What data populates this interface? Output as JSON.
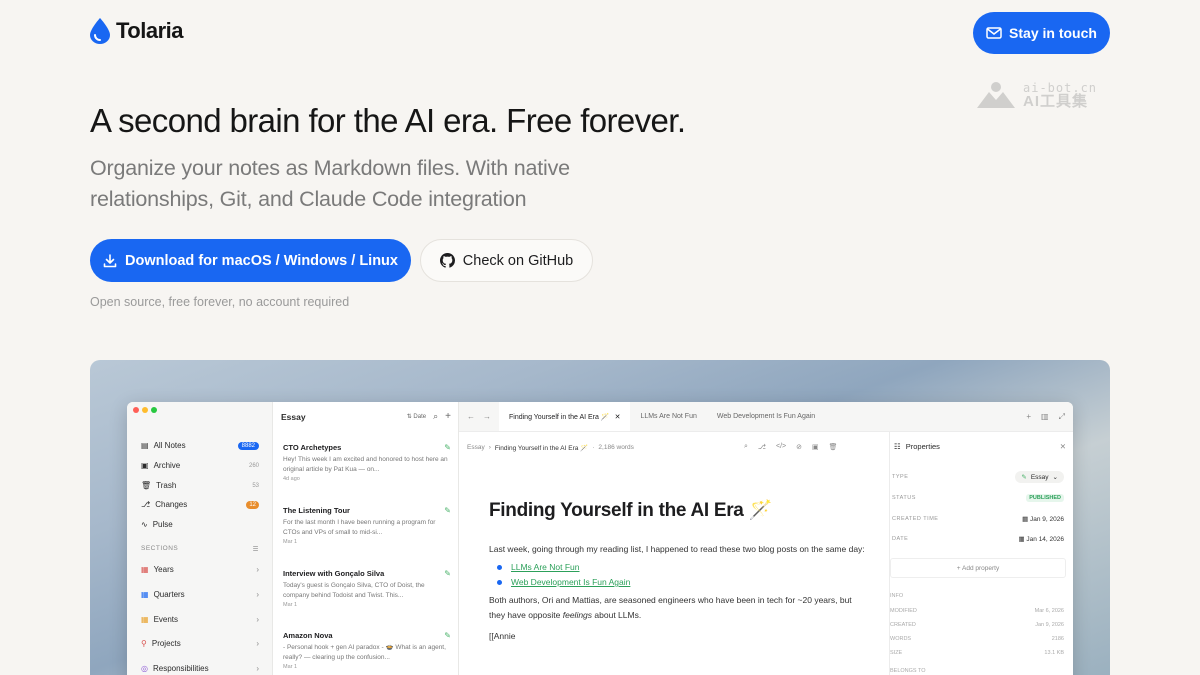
{
  "brand": {
    "name": "Tolaria",
    "accent": "#1967f2"
  },
  "nav": {
    "cta_label": "Stay in touch"
  },
  "watermark": {
    "line1": "ai-bot.cn",
    "line2": "AI工具集"
  },
  "hero": {
    "headline": "A second brain for the AI era. Free forever.",
    "subtitle": "Organize your notes as Markdown files. With native relationships, Git, and Claude Code integration",
    "download_label": "Download for macOS / Windows / Linux",
    "github_label": "Check on GitHub",
    "note": "Open source, free forever, no account required"
  },
  "app": {
    "sidebar": {
      "items": [
        {
          "label": "All Notes",
          "count": "8882",
          "icon": "notes-icon"
        },
        {
          "label": "Archive",
          "count": "260",
          "icon": "archive-icon"
        },
        {
          "label": "Trash",
          "count": "53",
          "icon": "trash-icon"
        },
        {
          "label": "Changes",
          "count": "12",
          "icon": "changes-icon"
        },
        {
          "label": "Pulse",
          "count": "",
          "icon": "pulse-icon"
        }
      ],
      "sections_label": "SECTIONS",
      "sections": [
        {
          "label": "Years",
          "icon": "calendar-icon"
        },
        {
          "label": "Quarters",
          "icon": "calendar-icon"
        },
        {
          "label": "Events",
          "icon": "event-icon"
        },
        {
          "label": "Projects",
          "icon": "project-icon"
        },
        {
          "label": "Responsibilities",
          "icon": "target-icon"
        }
      ]
    },
    "list": {
      "title": "Essay",
      "sort_label": "Date",
      "notes": [
        {
          "title": "CTO Archetypes",
          "preview": "Hey! This week I am excited and honored to host here an original article by Pat Kua — on...",
          "date": "4d ago"
        },
        {
          "title": "The Listening Tour",
          "preview": "For the last month I have been running a program for CTOs and VPs of small to mid-si...",
          "date": "Mar 1"
        },
        {
          "title": "Interview with Gonçalo Silva",
          "preview": "Today's guest is Gonçalo Silva, CTO of Doist, the company behind Todoist and Twist. This...",
          "date": "Mar 1"
        },
        {
          "title": "Amazon Nova",
          "preview": "- Personal hook + gen AI paradox - 🍲 What is an agent, really? — clearing up the confusion...",
          "date": "Mar 1"
        }
      ]
    },
    "tabs": [
      {
        "label": "Finding Yourself in the AI Era 🪄",
        "active": true
      },
      {
        "label": "LLMs Are Not Fun",
        "active": false
      },
      {
        "label": "Web Development Is Fun Again",
        "active": false
      }
    ],
    "breadcrumb": {
      "root": "Essay",
      "current": "Finding Yourself in the AI Era 🪄",
      "words": "2,186 words"
    },
    "doc": {
      "title": "Finding Yourself in the AI Era 🪄",
      "p1": "Last week, going through my reading list, I happened to read these two blog posts on the same day:",
      "links": [
        "LLMs Are Not Fun",
        "Web Development Is Fun Again"
      ],
      "p2_a": "Both authors, Ori and Mattias, are seasoned engineers who have been in tech for ~20 years, but they have opposite ",
      "p2_em": "feelings",
      "p2_b": " about LLMs.",
      "p3": "[[Annie"
    },
    "properties": {
      "title": "Properties",
      "type_label": "TYPE",
      "type_value": "Essay",
      "status_label": "STATUS",
      "status_value": "PUBLISHED",
      "created_label": "CREATED TIME",
      "created_value": "Jan 9, 2026",
      "date_label": "DATE",
      "date_value": "Jan 14, 2026",
      "add_label": "+ Add property",
      "info_label": "INFO",
      "info": [
        {
          "k": "MODIFIED",
          "v": "Mar 6, 2026"
        },
        {
          "k": "CREATED",
          "v": "Jan 9, 2026"
        },
        {
          "k": "WORDS",
          "v": "2186"
        },
        {
          "k": "SIZE",
          "v": "13.1 KB"
        }
      ],
      "belongs_label": "BELONGS TO"
    }
  }
}
